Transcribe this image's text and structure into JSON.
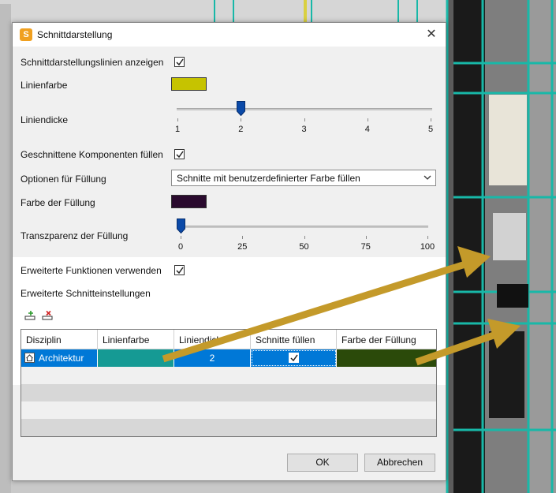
{
  "dialog": {
    "title": "Schnittdarstellung",
    "app_icon_letter": "S",
    "close_glyph": "✕"
  },
  "settings": {
    "show_lines_label": "Schnittdarstellungslinien anzeigen",
    "show_lines_checked": true,
    "line_color_label": "Linienfarbe",
    "line_color": "#c6c300",
    "line_width_label": "Liniendicke",
    "line_width_value": 2,
    "line_width_ticks": [
      "1",
      "2",
      "3",
      "4",
      "5"
    ],
    "fill_components_label": "Geschnittene Komponenten füllen",
    "fill_components_checked": true,
    "fill_options_label": "Optionen für Füllung",
    "fill_options_value": "Schnitte mit benutzerdefinierter Farbe füllen",
    "fill_color_label": "Farbe der Füllung",
    "fill_color": "#2a0a2e",
    "transparency_label": "Transzparenz der Füllung",
    "transparency_value": 0,
    "transparency_ticks": [
      "0",
      "25",
      "50",
      "75",
      "100"
    ]
  },
  "advanced": {
    "use_advanced_label": "Erweiterte Funktionen verwenden",
    "use_advanced_checked": true,
    "section_label": "Erweiterte Schnitteinstellungen",
    "add_icon": "add-row-icon",
    "remove_icon": "remove-row-icon",
    "columns": [
      "Disziplin",
      "Linienfarbe",
      "Liniendicke",
      "Schnitte füllen",
      "Farbe der Füllung"
    ],
    "rows": [
      {
        "discipline": "Architektur",
        "discipline_icon": "house-icon",
        "line_color": "#159a94",
        "line_width": "2",
        "fill_sections": true,
        "fill_color": "#2b4a0a"
      }
    ]
  },
  "buttons": {
    "ok": "OK",
    "cancel": "Abbrechen"
  },
  "colors": {
    "accent": "#0078d7",
    "arrow": "#c49a2a",
    "slider_thumb": "#0b4aa8"
  }
}
